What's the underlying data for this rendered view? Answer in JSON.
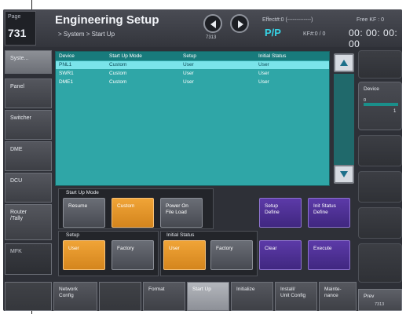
{
  "header": {
    "page_label": "Page",
    "page_number": "731",
    "title": "Engineering Setup",
    "breadcrumb": "> System > Start Up",
    "nav_number": "7313",
    "effect_label": "Effect#:0 (-------------)",
    "pp_label": "P/P",
    "kf_label": "KF#:0 / 0",
    "free_kf_label": "Free KF : 0",
    "timecode": "00: 00: 00: 00"
  },
  "left_tabs": [
    {
      "label": "Syste...",
      "selected": true
    },
    {
      "label": "Panel"
    },
    {
      "label": "Switcher"
    },
    {
      "label": "DME"
    },
    {
      "label": "DCU"
    },
    {
      "label": "Router\n/Tally"
    },
    {
      "label": "MFK"
    }
  ],
  "table": {
    "columns": [
      "Device",
      "Start Up Mode",
      "Setup",
      "Initial Status"
    ],
    "rows": [
      {
        "device": "PNL1",
        "mode": "Custom",
        "setup": "User",
        "status": "User",
        "selected": true
      },
      {
        "device": "SWR1",
        "mode": "Custom",
        "setup": "User",
        "status": "User"
      },
      {
        "device": "DME1",
        "mode": "Custom",
        "setup": "User",
        "status": "User"
      }
    ]
  },
  "start_up_mode": {
    "label": "Start Up Mode",
    "resume": "Resume",
    "custom": "Custom",
    "power_on": "Power On\nFile Load"
  },
  "setup_define": "Setup\nDefine",
  "init_status_define": "Init Status\nDefine",
  "setup_group": {
    "label": "Setup",
    "user": "User",
    "factory": "Factory"
  },
  "initial_status_group": {
    "label": "Initial Status",
    "user": "User",
    "factory": "Factory"
  },
  "clear": "Clear",
  "execute": "Execute",
  "bottom_tabs": [
    {
      "label": "Network\nConfig"
    },
    {
      "label": ""
    },
    {
      "label": "Format"
    },
    {
      "label": "Start Up",
      "selected": true
    },
    {
      "label": "Initialize"
    },
    {
      "label": "Install/\nUnit Config"
    },
    {
      "label": "Mainte-\nnance"
    }
  ],
  "right": {
    "device_label": "Device",
    "device_value_left": "0",
    "device_value_right": "1",
    "prev_label": "Prev",
    "prev_number": "7313"
  },
  "colors": {
    "table_bg": "#2fa6a7",
    "selected_row": "#7ae4ea",
    "orange_button": "#f0a437",
    "purple_button": "#5c3aa8",
    "pp_color": "#36d4e6"
  }
}
